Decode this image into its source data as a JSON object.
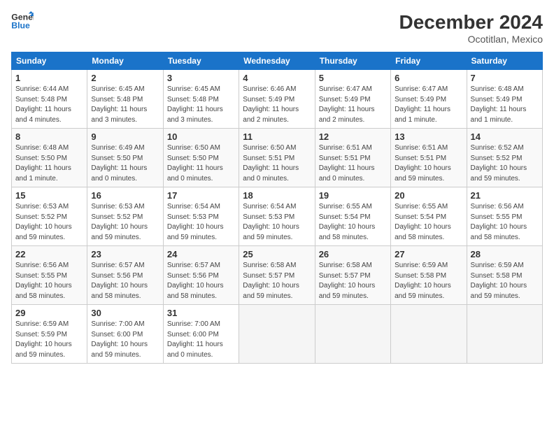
{
  "header": {
    "logo_line1": "General",
    "logo_line2": "Blue",
    "month": "December 2024",
    "location": "Ocotitlan, Mexico"
  },
  "weekdays": [
    "Sunday",
    "Monday",
    "Tuesday",
    "Wednesday",
    "Thursday",
    "Friday",
    "Saturday"
  ],
  "weeks": [
    [
      {
        "day": "1",
        "info": "Sunrise: 6:44 AM\nSunset: 5:48 PM\nDaylight: 11 hours and 4 minutes."
      },
      {
        "day": "2",
        "info": "Sunrise: 6:45 AM\nSunset: 5:48 PM\nDaylight: 11 hours and 3 minutes."
      },
      {
        "day": "3",
        "info": "Sunrise: 6:45 AM\nSunset: 5:48 PM\nDaylight: 11 hours and 3 minutes."
      },
      {
        "day": "4",
        "info": "Sunrise: 6:46 AM\nSunset: 5:49 PM\nDaylight: 11 hours and 2 minutes."
      },
      {
        "day": "5",
        "info": "Sunrise: 6:47 AM\nSunset: 5:49 PM\nDaylight: 11 hours and 2 minutes."
      },
      {
        "day": "6",
        "info": "Sunrise: 6:47 AM\nSunset: 5:49 PM\nDaylight: 11 hours and 1 minute."
      },
      {
        "day": "7",
        "info": "Sunrise: 6:48 AM\nSunset: 5:49 PM\nDaylight: 11 hours and 1 minute."
      }
    ],
    [
      {
        "day": "8",
        "info": "Sunrise: 6:48 AM\nSunset: 5:50 PM\nDaylight: 11 hours and 1 minute."
      },
      {
        "day": "9",
        "info": "Sunrise: 6:49 AM\nSunset: 5:50 PM\nDaylight: 11 hours and 0 minutes."
      },
      {
        "day": "10",
        "info": "Sunrise: 6:50 AM\nSunset: 5:50 PM\nDaylight: 11 hours and 0 minutes."
      },
      {
        "day": "11",
        "info": "Sunrise: 6:50 AM\nSunset: 5:51 PM\nDaylight: 11 hours and 0 minutes."
      },
      {
        "day": "12",
        "info": "Sunrise: 6:51 AM\nSunset: 5:51 PM\nDaylight: 11 hours and 0 minutes."
      },
      {
        "day": "13",
        "info": "Sunrise: 6:51 AM\nSunset: 5:51 PM\nDaylight: 10 hours and 59 minutes."
      },
      {
        "day": "14",
        "info": "Sunrise: 6:52 AM\nSunset: 5:52 PM\nDaylight: 10 hours and 59 minutes."
      }
    ],
    [
      {
        "day": "15",
        "info": "Sunrise: 6:53 AM\nSunset: 5:52 PM\nDaylight: 10 hours and 59 minutes."
      },
      {
        "day": "16",
        "info": "Sunrise: 6:53 AM\nSunset: 5:52 PM\nDaylight: 10 hours and 59 minutes."
      },
      {
        "day": "17",
        "info": "Sunrise: 6:54 AM\nSunset: 5:53 PM\nDaylight: 10 hours and 59 minutes."
      },
      {
        "day": "18",
        "info": "Sunrise: 6:54 AM\nSunset: 5:53 PM\nDaylight: 10 hours and 59 minutes."
      },
      {
        "day": "19",
        "info": "Sunrise: 6:55 AM\nSunset: 5:54 PM\nDaylight: 10 hours and 58 minutes."
      },
      {
        "day": "20",
        "info": "Sunrise: 6:55 AM\nSunset: 5:54 PM\nDaylight: 10 hours and 58 minutes."
      },
      {
        "day": "21",
        "info": "Sunrise: 6:56 AM\nSunset: 5:55 PM\nDaylight: 10 hours and 58 minutes."
      }
    ],
    [
      {
        "day": "22",
        "info": "Sunrise: 6:56 AM\nSunset: 5:55 PM\nDaylight: 10 hours and 58 minutes."
      },
      {
        "day": "23",
        "info": "Sunrise: 6:57 AM\nSunset: 5:56 PM\nDaylight: 10 hours and 58 minutes."
      },
      {
        "day": "24",
        "info": "Sunrise: 6:57 AM\nSunset: 5:56 PM\nDaylight: 10 hours and 58 minutes."
      },
      {
        "day": "25",
        "info": "Sunrise: 6:58 AM\nSunset: 5:57 PM\nDaylight: 10 hours and 59 minutes."
      },
      {
        "day": "26",
        "info": "Sunrise: 6:58 AM\nSunset: 5:57 PM\nDaylight: 10 hours and 59 minutes."
      },
      {
        "day": "27",
        "info": "Sunrise: 6:59 AM\nSunset: 5:58 PM\nDaylight: 10 hours and 59 minutes."
      },
      {
        "day": "28",
        "info": "Sunrise: 6:59 AM\nSunset: 5:58 PM\nDaylight: 10 hours and 59 minutes."
      }
    ],
    [
      {
        "day": "29",
        "info": "Sunrise: 6:59 AM\nSunset: 5:59 PM\nDaylight: 10 hours and 59 minutes."
      },
      {
        "day": "30",
        "info": "Sunrise: 7:00 AM\nSunset: 6:00 PM\nDaylight: 10 hours and 59 minutes."
      },
      {
        "day": "31",
        "info": "Sunrise: 7:00 AM\nSunset: 6:00 PM\nDaylight: 11 hours and 0 minutes."
      },
      null,
      null,
      null,
      null
    ]
  ]
}
